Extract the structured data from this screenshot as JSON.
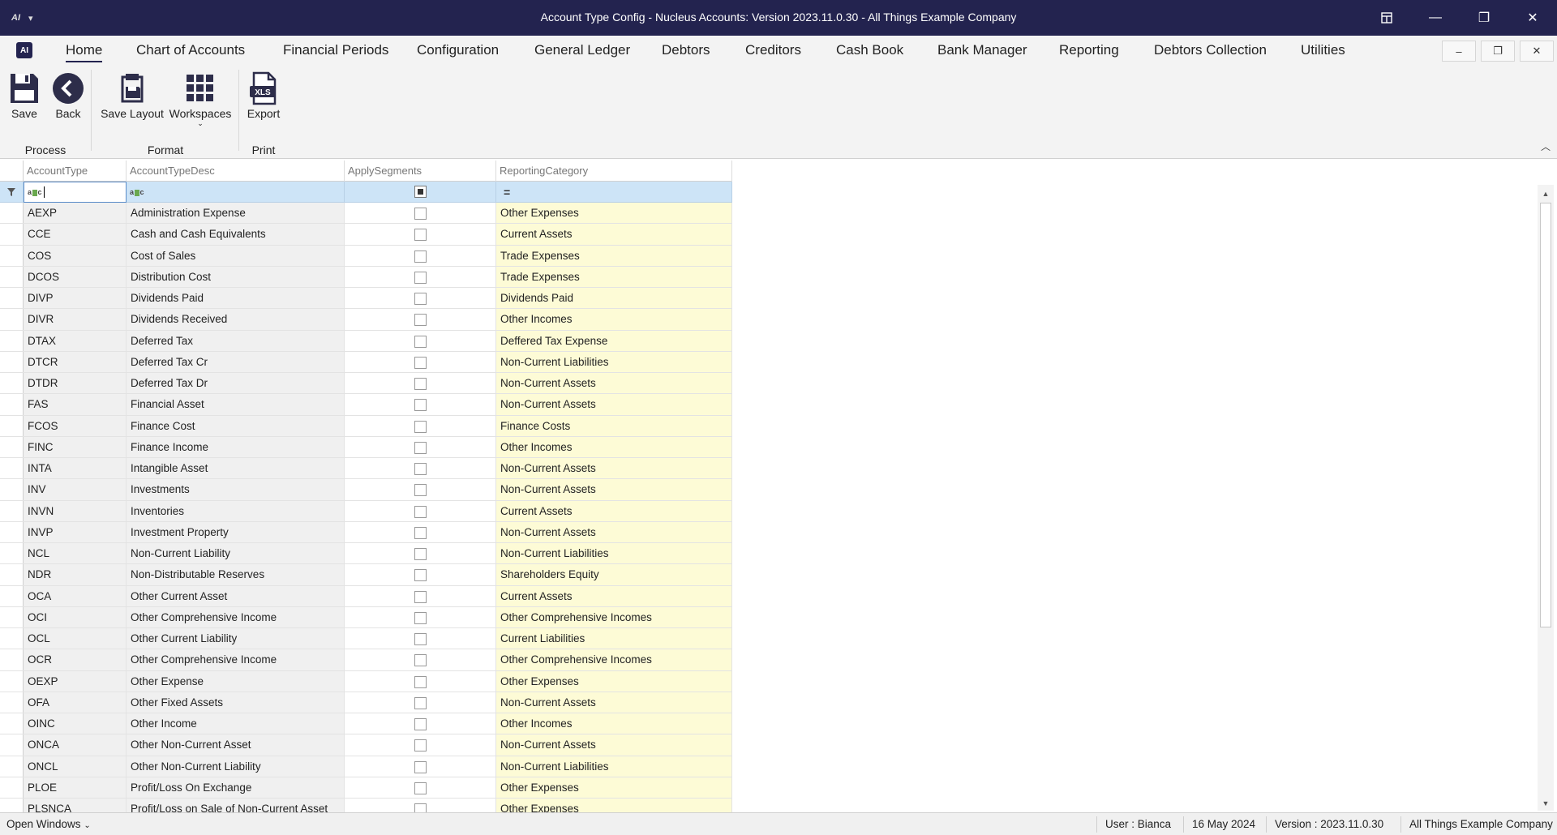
{
  "window": {
    "title": "Account Type Config - Nucleus Accounts: Version 2023.11.0.30 - All Things Example Company",
    "app_menu_label": "AI"
  },
  "menu": {
    "items": [
      "Home",
      "Chart of Accounts",
      "Financial Periods",
      "Configuration",
      "General Ledger",
      "Debtors",
      "Creditors",
      "Cash Book",
      "Bank Manager",
      "Reporting",
      "Debtors Collection",
      "Utilities"
    ],
    "active": "Home"
  },
  "ribbon": {
    "buttons": {
      "save": "Save",
      "back": "Back",
      "save_layout": "Save Layout",
      "workspaces": "Workspaces",
      "export": "Export"
    },
    "groups": {
      "process": "Process",
      "format": "Format",
      "print": "Print"
    },
    "export_icon_text": "XLS"
  },
  "grid": {
    "columns": [
      "AccountType",
      "AccountTypeDesc",
      "ApplySegments",
      "ReportingCategory"
    ],
    "filter": {
      "category_operator": "="
    },
    "rows": [
      {
        "type": "AEXP",
        "desc": "Administration Expense",
        "apply_segments": false,
        "category": "Other Expenses"
      },
      {
        "type": "CCE",
        "desc": "Cash and Cash Equivalents",
        "apply_segments": false,
        "category": "Current Assets"
      },
      {
        "type": "COS",
        "desc": "Cost of Sales",
        "apply_segments": false,
        "category": "Trade Expenses"
      },
      {
        "type": "DCOS",
        "desc": "Distribution Cost",
        "apply_segments": false,
        "category": "Trade Expenses"
      },
      {
        "type": "DIVP",
        "desc": "Dividends Paid",
        "apply_segments": false,
        "category": "Dividends Paid"
      },
      {
        "type": "DIVR",
        "desc": "Dividends Received",
        "apply_segments": false,
        "category": "Other Incomes"
      },
      {
        "type": "DTAX",
        "desc": "Deferred Tax",
        "apply_segments": false,
        "category": "Deffered Tax Expense"
      },
      {
        "type": "DTCR",
        "desc": "Deferred Tax Cr",
        "apply_segments": false,
        "category": "Non-Current Liabilities"
      },
      {
        "type": "DTDR",
        "desc": "Deferred Tax Dr",
        "apply_segments": false,
        "category": "Non-Current Assets"
      },
      {
        "type": "FAS",
        "desc": "Financial Asset",
        "apply_segments": false,
        "category": "Non-Current Assets"
      },
      {
        "type": "FCOS",
        "desc": "Finance Cost",
        "apply_segments": false,
        "category": "Finance Costs"
      },
      {
        "type": "FINC",
        "desc": "Finance Income",
        "apply_segments": false,
        "category": "Other Incomes"
      },
      {
        "type": "INTA",
        "desc": "Intangible Asset",
        "apply_segments": false,
        "category": "Non-Current Assets"
      },
      {
        "type": "INV",
        "desc": "Investments",
        "apply_segments": false,
        "category": "Non-Current Assets"
      },
      {
        "type": "INVN",
        "desc": "Inventories",
        "apply_segments": false,
        "category": "Current Assets"
      },
      {
        "type": "INVP",
        "desc": "Investment Property",
        "apply_segments": false,
        "category": "Non-Current Assets"
      },
      {
        "type": "NCL",
        "desc": "Non-Current Liability",
        "apply_segments": false,
        "category": "Non-Current Liabilities"
      },
      {
        "type": "NDR",
        "desc": "Non-Distributable Reserves",
        "apply_segments": false,
        "category": "Shareholders Equity"
      },
      {
        "type": "OCA",
        "desc": "Other Current Asset",
        "apply_segments": false,
        "category": "Current Assets"
      },
      {
        "type": "OCI",
        "desc": "Other Comprehensive Income",
        "apply_segments": false,
        "category": "Other Comprehensive Incomes"
      },
      {
        "type": "OCL",
        "desc": "Other Current Liability",
        "apply_segments": false,
        "category": "Current Liabilities"
      },
      {
        "type": "OCR",
        "desc": "Other Comprehensive Income",
        "apply_segments": false,
        "category": "Other Comprehensive Incomes"
      },
      {
        "type": "OEXP",
        "desc": "Other Expense",
        "apply_segments": false,
        "category": "Other Expenses"
      },
      {
        "type": "OFA",
        "desc": "Other Fixed Assets",
        "apply_segments": false,
        "category": "Non-Current Assets"
      },
      {
        "type": "OINC",
        "desc": "Other Income",
        "apply_segments": false,
        "category": "Other Incomes"
      },
      {
        "type": "ONCA",
        "desc": "Other Non-Current Asset",
        "apply_segments": false,
        "category": "Non-Current Assets"
      },
      {
        "type": "ONCL",
        "desc": "Other Non-Current Liability",
        "apply_segments": false,
        "category": "Non-Current Liabilities"
      },
      {
        "type": "PLOE",
        "desc": "Profit/Loss On Exchange",
        "apply_segments": false,
        "category": "Other Expenses"
      },
      {
        "type": "PLSNCA",
        "desc": "Profit/Loss on Sale of Non-Current Asset",
        "apply_segments": false,
        "category": "Other Expenses"
      }
    ]
  },
  "statusbar": {
    "open_windows": "Open Windows",
    "user": "User : Bianca",
    "date": "16 May 2024",
    "version": "Version : 2023.11.0.30",
    "company": "All Things Example Company"
  },
  "colors": {
    "titlebar": "#23234f",
    "category_column": "#fdfbd6",
    "filter_row": "#cde4f7"
  }
}
